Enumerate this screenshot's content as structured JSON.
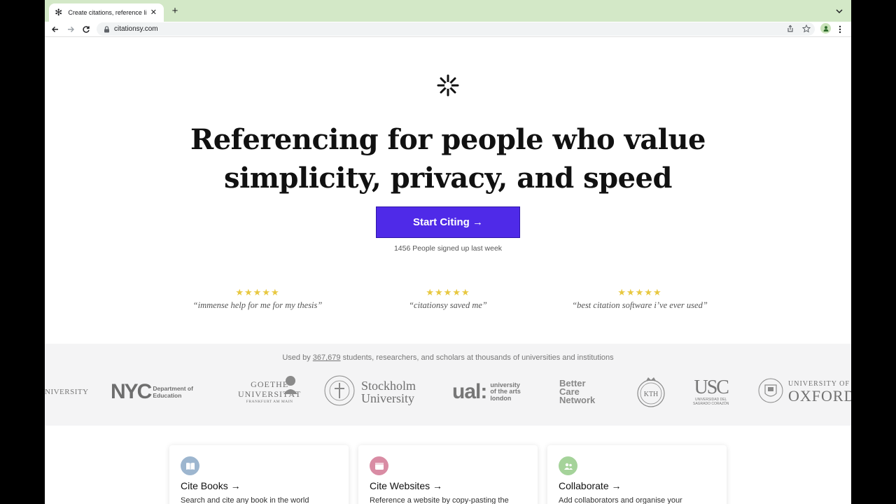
{
  "browser": {
    "tab_title": "Create citations, reference lists",
    "url": "citationsy.com",
    "new_tab_symbol": "+",
    "close_symbol": "✕"
  },
  "hero": {
    "logo_symbol": "✻",
    "headline_line1": "Referencing for people who value",
    "headline_line2": "simplicity, privacy, and speed",
    "cta_label": "Start Citing →",
    "signups_text": "1456 People signed up last week"
  },
  "reviews": [
    {
      "stars": "★★★★★",
      "quote": "“immense help for me for my thesis”"
    },
    {
      "stars": "★★★★★",
      "quote": "“citationsy saved me”"
    },
    {
      "stars": "★★★★★",
      "quote": "“best citation software i’ve ever used”"
    }
  ],
  "institutions": {
    "used_prefix": "Used by ",
    "used_count": "367,679",
    "used_suffix": " students, researchers, and scholars at thousands of universities and institutions",
    "logos": [
      {
        "name": "university-partial-logo",
        "text": "NIVERSITY"
      },
      {
        "name": "nyc-doe-logo",
        "big": "NYC",
        "small1": "Department of",
        "small2": "Education"
      },
      {
        "name": "goethe-logo",
        "line1": "GOETHE",
        "line2": "UNIVERSITÄT",
        "line3": "FRANKFURT AM MAIN"
      },
      {
        "name": "stockholm-logo",
        "line1": "Stockholm",
        "line2": "University"
      },
      {
        "name": "ual-logo",
        "big": "ual:",
        "small1": "university",
        "small2": "of the arts",
        "small3": "london"
      },
      {
        "name": "better-care-logo",
        "line1": "Better",
        "line2": "Care",
        "line3": "Network"
      },
      {
        "name": "kth-logo",
        "text": "KTH"
      },
      {
        "name": "usc-logo",
        "big": "USC",
        "small1": "UNIVERSIDAD DEL",
        "small2": "SAGRADO CORAZÓN"
      },
      {
        "name": "oxford-logo",
        "line1": "UNIVERSITY OF",
        "line2": "OXFORD"
      }
    ]
  },
  "features": [
    {
      "title": "Cite Books →",
      "desc": "Search and cite any book in the world",
      "color": "#9db6cf"
    },
    {
      "title": "Cite Websites →",
      "desc": "Reference a website by copy-pasting the",
      "color": "#d98ca4"
    },
    {
      "title": "Collaborate →",
      "desc": "Add collaborators and organise your",
      "color": "#a5d39a"
    }
  ]
}
